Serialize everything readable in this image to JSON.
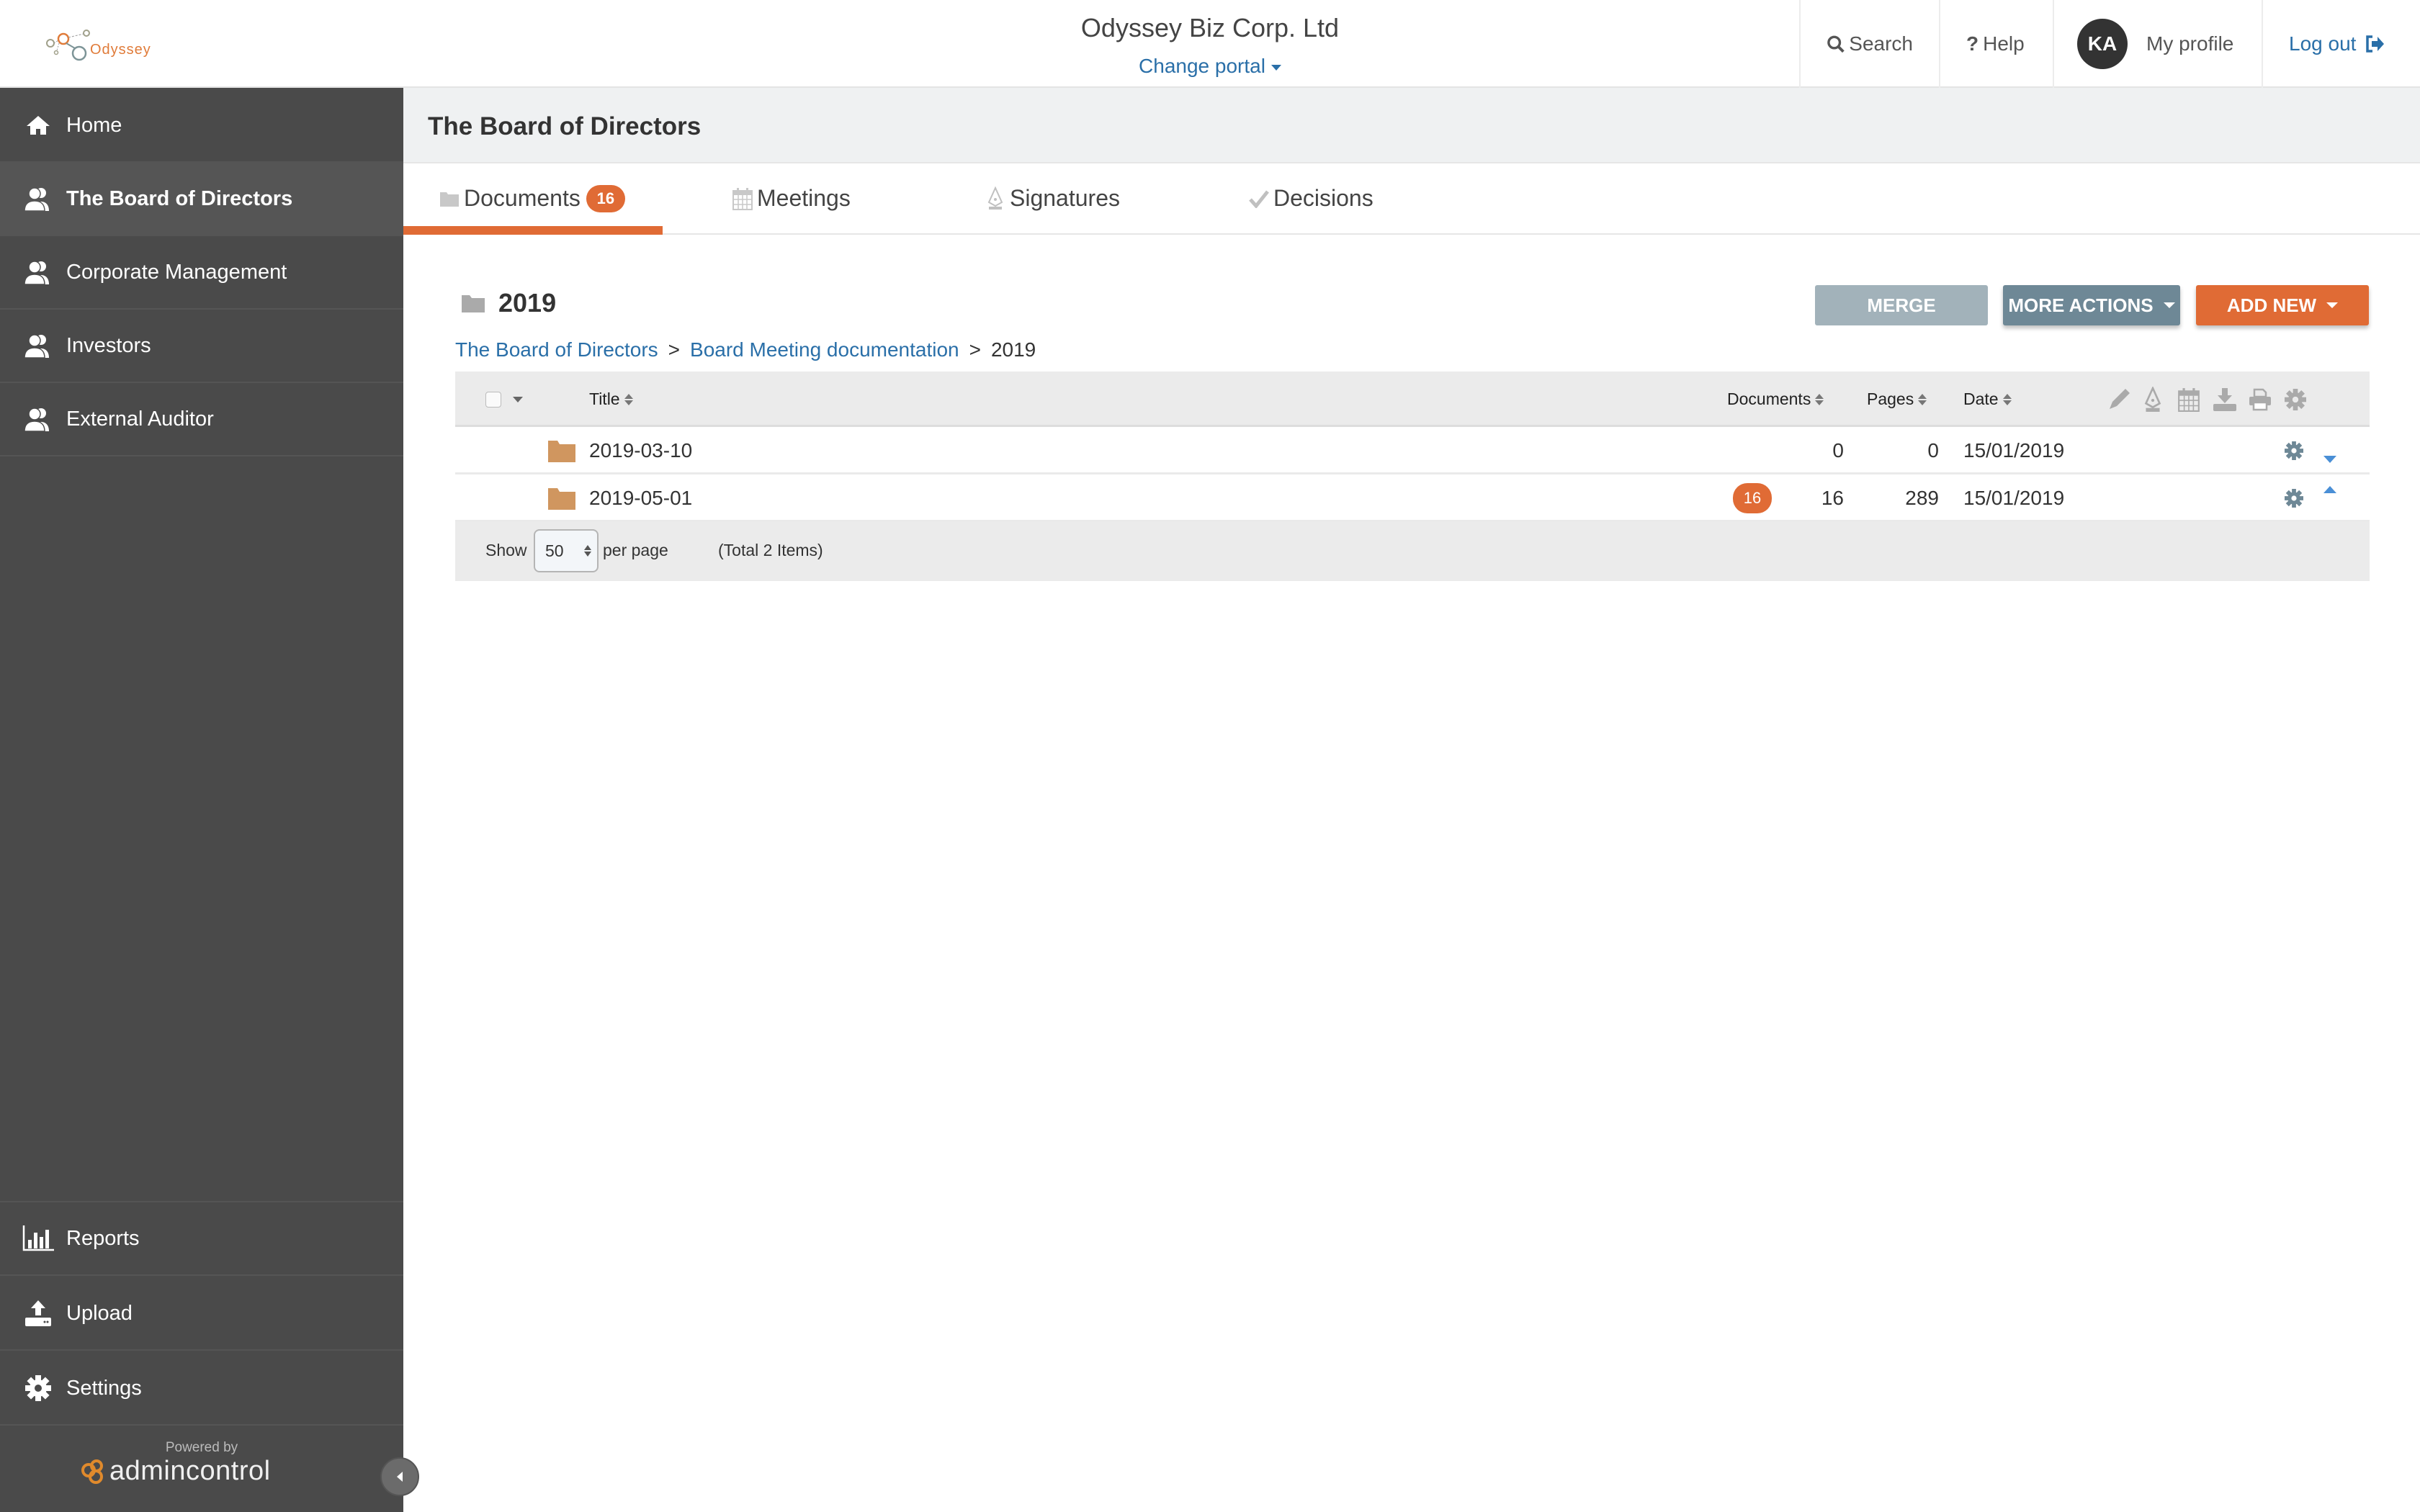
{
  "header": {
    "logo_text": "Odyssey",
    "company": "Odyssey Biz Corp. Ltd",
    "change_portal": "Change portal",
    "search": "Search",
    "help": "Help",
    "avatar_initials": "KA",
    "my_profile": "My profile",
    "logout": "Log out"
  },
  "sidebar": {
    "items": [
      {
        "label": "Home",
        "icon": "home-icon"
      },
      {
        "label": "The Board of Directors",
        "icon": "users-icon",
        "active": true
      },
      {
        "label": "Corporate Management",
        "icon": "users-icon"
      },
      {
        "label": "Investors",
        "icon": "users-icon"
      },
      {
        "label": "External Auditor",
        "icon": "users-icon"
      }
    ],
    "bottom_items": [
      {
        "label": "Reports",
        "icon": "bar-chart-icon"
      },
      {
        "label": "Upload",
        "icon": "upload-icon"
      },
      {
        "label": "Settings",
        "icon": "gear-icon"
      }
    ],
    "powered_by": "Powered by",
    "brand": "admincontrol"
  },
  "page": {
    "title": "The Board of Directors",
    "tabs": [
      {
        "label": "Documents",
        "badge": "16",
        "active": true
      },
      {
        "label": "Meetings"
      },
      {
        "label": "Signatures"
      },
      {
        "label": "Decisions"
      }
    ]
  },
  "folder": {
    "name": "2019",
    "buttons": {
      "merge": "MERGE",
      "more_actions": "MORE ACTIONS",
      "add_new": "ADD NEW"
    },
    "breadcrumb": [
      "The Board of Directors",
      "Board Meeting documentation",
      "2019"
    ],
    "breadcrumb_sep": ">"
  },
  "table": {
    "columns": {
      "title": "Title",
      "documents": "Documents",
      "pages": "Pages",
      "date": "Date"
    },
    "action_icons": [
      "edit-icon",
      "signature-icon",
      "calendar-icon",
      "download-icon",
      "print-icon",
      "gear-icon"
    ],
    "rows": [
      {
        "title": "2019-03-10",
        "badge": "",
        "documents": "0",
        "pages": "0",
        "date": "15/01/2019",
        "move": "down"
      },
      {
        "title": "2019-05-01",
        "badge": "16",
        "documents": "16",
        "pages": "289",
        "date": "15/01/2019",
        "move": "up"
      }
    ],
    "footer": {
      "show": "Show",
      "per_page_value": "50",
      "per_page": "per page",
      "total": "(Total 2 Items)"
    }
  },
  "colors": {
    "accent": "#e06b35",
    "link": "#2a6fa8",
    "sidebar": "#4a4a4a",
    "folder": "#d0965f"
  }
}
